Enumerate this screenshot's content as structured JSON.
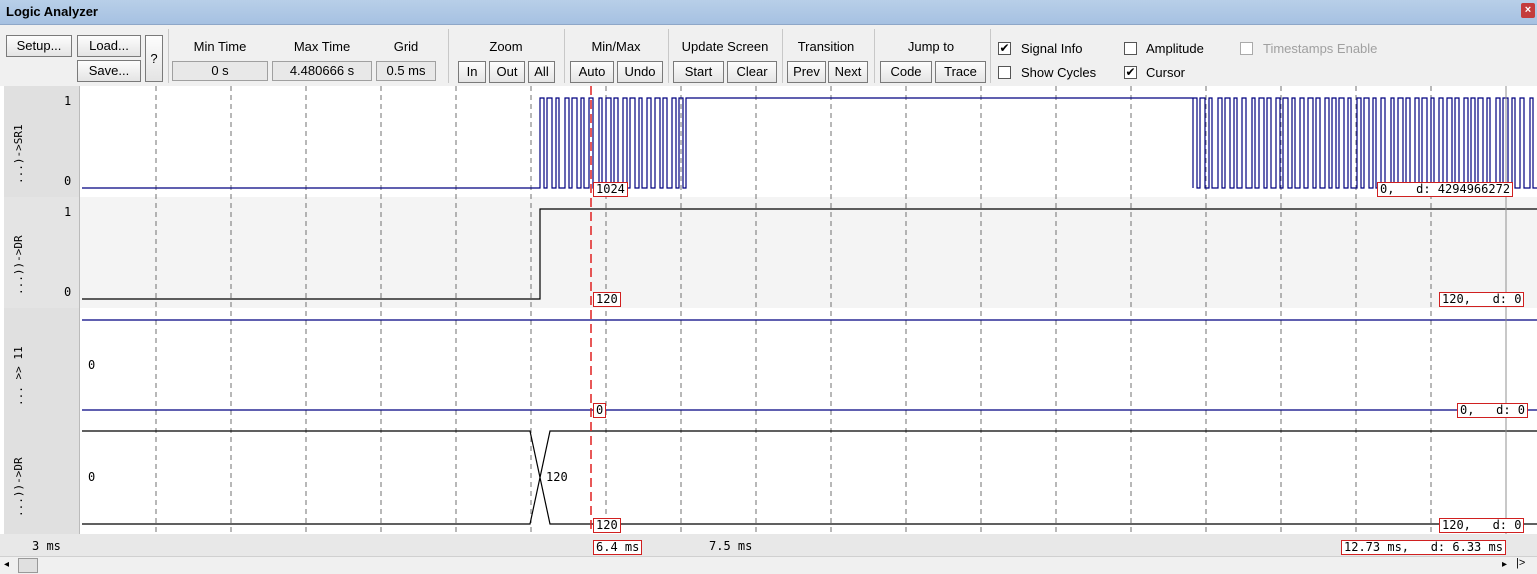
{
  "window": {
    "title": "Logic Analyzer",
    "close_glyph": "×"
  },
  "toolbar": {
    "setup": "Setup...",
    "load": "Load...",
    "save": "Save...",
    "help": "?",
    "min_time_label": "Min Time",
    "min_time_value": "0 s",
    "max_time_label": "Max Time",
    "max_time_value": "4.480666 s",
    "grid_label": "Grid",
    "grid_value": "0.5 ms",
    "zoom_label": "Zoom",
    "zoom_in": "In",
    "zoom_out": "Out",
    "zoom_all": "All",
    "minmax_label": "Min/Max",
    "auto": "Auto",
    "undo": "Undo",
    "update_label": "Update Screen",
    "start": "Start",
    "clear": "Clear",
    "transition_label": "Transition",
    "prev": "Prev",
    "next": "Next",
    "jump_label": "Jump to",
    "code": "Code",
    "trace": "Trace",
    "signal_info": "Signal Info",
    "amplitude": "Amplitude",
    "timestamps": "Timestamps Enable",
    "show_cycles": "Show Cycles",
    "cursor": "Cursor",
    "check_mark": "✔"
  },
  "signals": [
    {
      "name": "...)->SR1",
      "hi": "1",
      "lo": "0",
      "cursor_val": "1024",
      "right_val": "0,   d: 4294966272"
    },
    {
      "name": "...))->DR",
      "hi": "1",
      "lo": "0",
      "cursor_val": "120",
      "right_val": "120,   d: 0"
    },
    {
      "name": "... >> 11",
      "value": "0",
      "cursor_val": "0",
      "right_val": "0,   d: 0"
    },
    {
      "name": "...))->DR",
      "value": "0",
      "bus_change": "120",
      "cursor_val": "120",
      "right_val": "120,   d: 0"
    }
  ],
  "timebar": {
    "left": "3 ms",
    "cursor": "6.4 ms",
    "mid": "7.5 ms",
    "right": "12.73 ms,   d: 6.33 ms"
  },
  "colors": {
    "signal_blue": "#000080",
    "cursor_red": "#e02020",
    "grid": "#606060"
  }
}
